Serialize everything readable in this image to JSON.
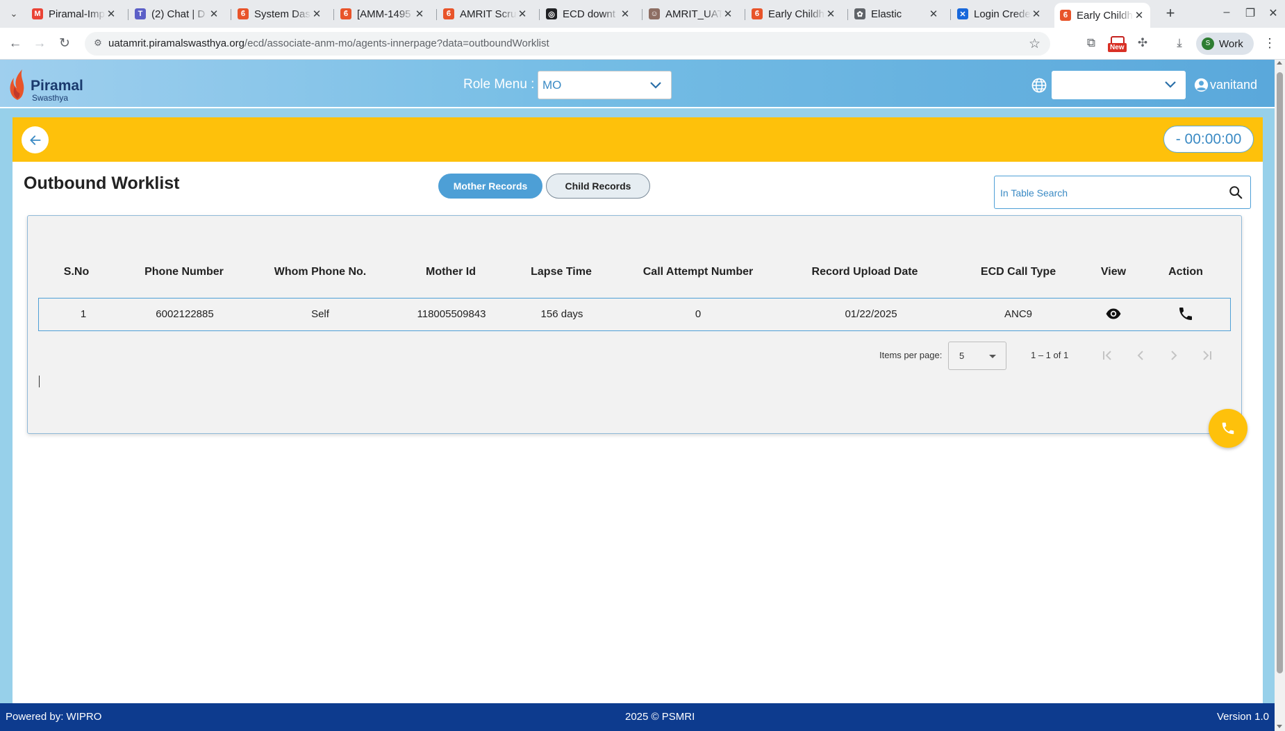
{
  "browser": {
    "tabs": [
      {
        "title": "Piramal-Imp",
        "icon": "gmail-icon",
        "color": "#ea4335",
        "glyph": "M"
      },
      {
        "title": "(2) Chat | D",
        "icon": "teams-icon",
        "color": "#5b5fc7",
        "glyph": "T"
      },
      {
        "title": "System Das",
        "icon": "piramal-icon",
        "color": "#e8542a",
        "glyph": "ϐ"
      },
      {
        "title": "[AMM-1495",
        "icon": "piramal-icon",
        "color": "#e8542a",
        "glyph": "ϐ"
      },
      {
        "title": "AMRIT Scru",
        "icon": "piramal-icon",
        "color": "#e8542a",
        "glyph": "ϐ"
      },
      {
        "title": "ECD downt",
        "icon": "chatgpt-icon",
        "color": "#202124",
        "glyph": "◎"
      },
      {
        "title": "AMRIT_UAT",
        "icon": "avatar-icon",
        "color": "#8d6e63",
        "glyph": "☺"
      },
      {
        "title": "Early Childh",
        "icon": "piramal-icon",
        "color": "#e8542a",
        "glyph": "ϐ"
      },
      {
        "title": "Elastic",
        "icon": "elastic-icon",
        "color": "#5f6368",
        "glyph": "✿"
      },
      {
        "title": "Login Crede",
        "icon": "confluence-icon",
        "color": "#1868db",
        "glyph": "✕"
      },
      {
        "title": "Early Childh",
        "icon": "piramal-icon",
        "color": "#e8542a",
        "glyph": "ϐ",
        "active": true
      }
    ],
    "url_host": "uatamrit.piramalswasthya.org",
    "url_path": "/ecd/associate-anm-mo/agents-innerpage?data=outboundWorklist",
    "new_badge": "New",
    "profile_initial": "S",
    "profile_label": "Work"
  },
  "header": {
    "logo_title": "Piramal",
    "logo_subtitle": "Swasthya",
    "role_label": "Role Menu :",
    "role_value": "MO",
    "username": "vanitand"
  },
  "toolbar": {
    "timer": "- 00:00:00"
  },
  "main": {
    "title": "Outbound Worklist",
    "tabs": [
      {
        "label": "Mother Records",
        "active": true
      },
      {
        "label": "Child Records",
        "active": false
      }
    ],
    "search_placeholder": "In Table Search"
  },
  "table": {
    "columns": [
      "S.No",
      "Phone Number",
      "Whom Phone No.",
      "Mother Id",
      "Lapse Time",
      "Call Attempt Number",
      "Record Upload Date",
      "ECD Call Type",
      "View",
      "Action"
    ],
    "rows": [
      {
        "sno": "1",
        "phone": "6002122885",
        "whom": "Self",
        "mother_id": "118005509843",
        "lapse": "156 days",
        "attempt": "0",
        "upload_date": "01/22/2025",
        "call_type": "ANC9",
        "view_icon": "eye-icon",
        "action_icon": "phone-icon"
      }
    ]
  },
  "pagination": {
    "items_label": "Items per page:",
    "page_size": "5",
    "range": "1 – 1 of 1"
  },
  "footer": {
    "left": "Powered by: WIPRO",
    "center": "2025 © PSMRI",
    "right": "Version 1.0"
  },
  "colors": {
    "header_gradient_start": "#9fcfee",
    "header_gradient_end": "#5aa8db",
    "accent_yellow": "#fec10b",
    "primary_blue": "#4d9fd6",
    "footer_navy": "#0d3b8e"
  }
}
